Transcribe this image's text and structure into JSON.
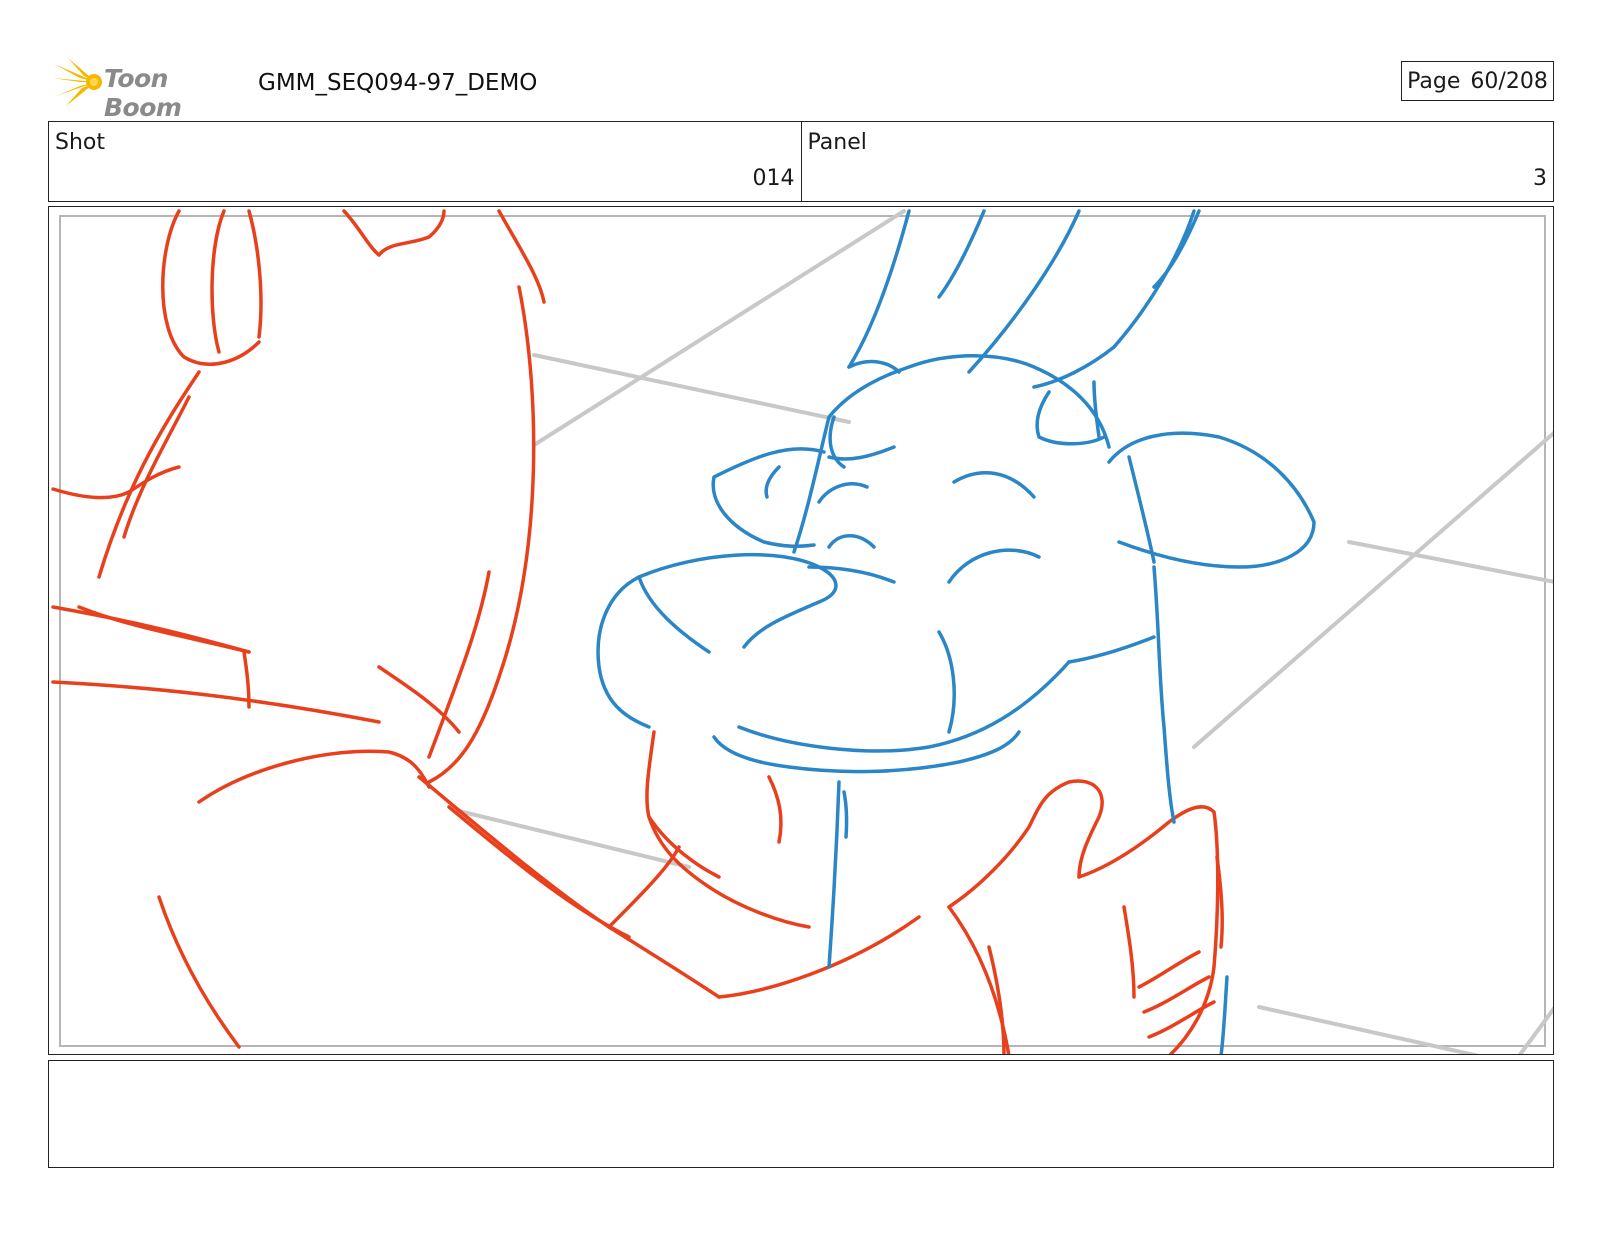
{
  "header": {
    "logo_text": "Toon Boom",
    "document_title": "GMM_SEQ094-97_DEMO",
    "page_label": "Page",
    "page_value": "60/208"
  },
  "info": {
    "shot_label": "Shot",
    "shot_value": "014",
    "panel_label": "Panel",
    "panel_value": "3"
  },
  "caption": {
    "text": ""
  },
  "colors": {
    "sketch_red": "#e8401c",
    "sketch_blue": "#2a86c6",
    "background_lines": "#c8c8c8",
    "logo_yellow": "#f5b800"
  }
}
